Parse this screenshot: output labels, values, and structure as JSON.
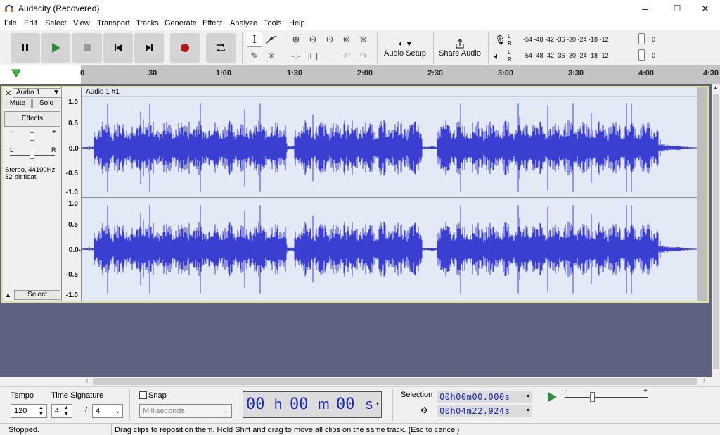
{
  "window": {
    "title": "Audacity (Recovered)",
    "minimize": "–",
    "maximize": "☐",
    "close": "✕"
  },
  "menu": [
    "File",
    "Edit",
    "Select",
    "View",
    "Transport",
    "Tracks",
    "Generate",
    "Effect",
    "Analyze",
    "Tools",
    "Help"
  ],
  "toolbar": {
    "audio_setup": "Audio Setup",
    "share_audio": "Share Audio",
    "meter_rec": {
      "l": "L",
      "r": "R",
      "scale": "-54 -48 -42 -36 -30 -24 -18 -12",
      "end": "0"
    },
    "meter_play": {
      "l": "L",
      "r": "R",
      "scale": "-54 -48 -42 -36 -30 -24 -18 -12",
      "end": "0"
    }
  },
  "ruler": {
    "ticks": [
      "0",
      "30",
      "1:00",
      "1:30",
      "2:00",
      "2:30",
      "3:00",
      "3:30",
      "4:00",
      "4:30"
    ]
  },
  "track": {
    "name": "Audio 1",
    "mute": "Mute",
    "solo": "Solo",
    "effects": "Effects",
    "gain_minus": "-",
    "gain_plus": "+",
    "pan_l": "L",
    "pan_r": "R",
    "info_line1": "Stereo, 44100Hz",
    "info_line2": "32-bit float",
    "select": "Select",
    "clip_name": "Audio 1 #1",
    "scale_top": [
      "1.0",
      "0.5",
      "0.0-",
      "-0.5",
      "-1.0"
    ],
    "scale_bottom": [
      "1.0",
      "0.5",
      "0.0-",
      "-0.5",
      "-1.0"
    ]
  },
  "bottom": {
    "tempo_label": "Tempo",
    "tempo_value": "120",
    "time_sig_label": "Time Signature",
    "time_sig_num": "4",
    "time_sig_slash": "/",
    "time_sig_den": "4",
    "snap_label": "Snap",
    "snap_unit": "Milliseconds",
    "time_h": "00",
    "time_h_unit": "h",
    "time_m": "00",
    "time_m_unit": "m",
    "time_s": "00",
    "time_s_unit": "s",
    "selection_label": "Selection",
    "sel_start": "00h00m00.000s",
    "sel_end": "00h04m22.924s",
    "speed_minus": "-",
    "speed_plus": "+"
  },
  "status": {
    "state": "Stopped.",
    "hint": "Drag clips to reposition them. Hold Shift and drag to move all clips on the same track. (Esc to cancel)"
  },
  "colors": {
    "wave": "#3b3fd1",
    "track_bg": "#e4e9f6",
    "selection_border": "#e5e38a",
    "record": "#b11a1a",
    "play": "#2e8b3a"
  }
}
